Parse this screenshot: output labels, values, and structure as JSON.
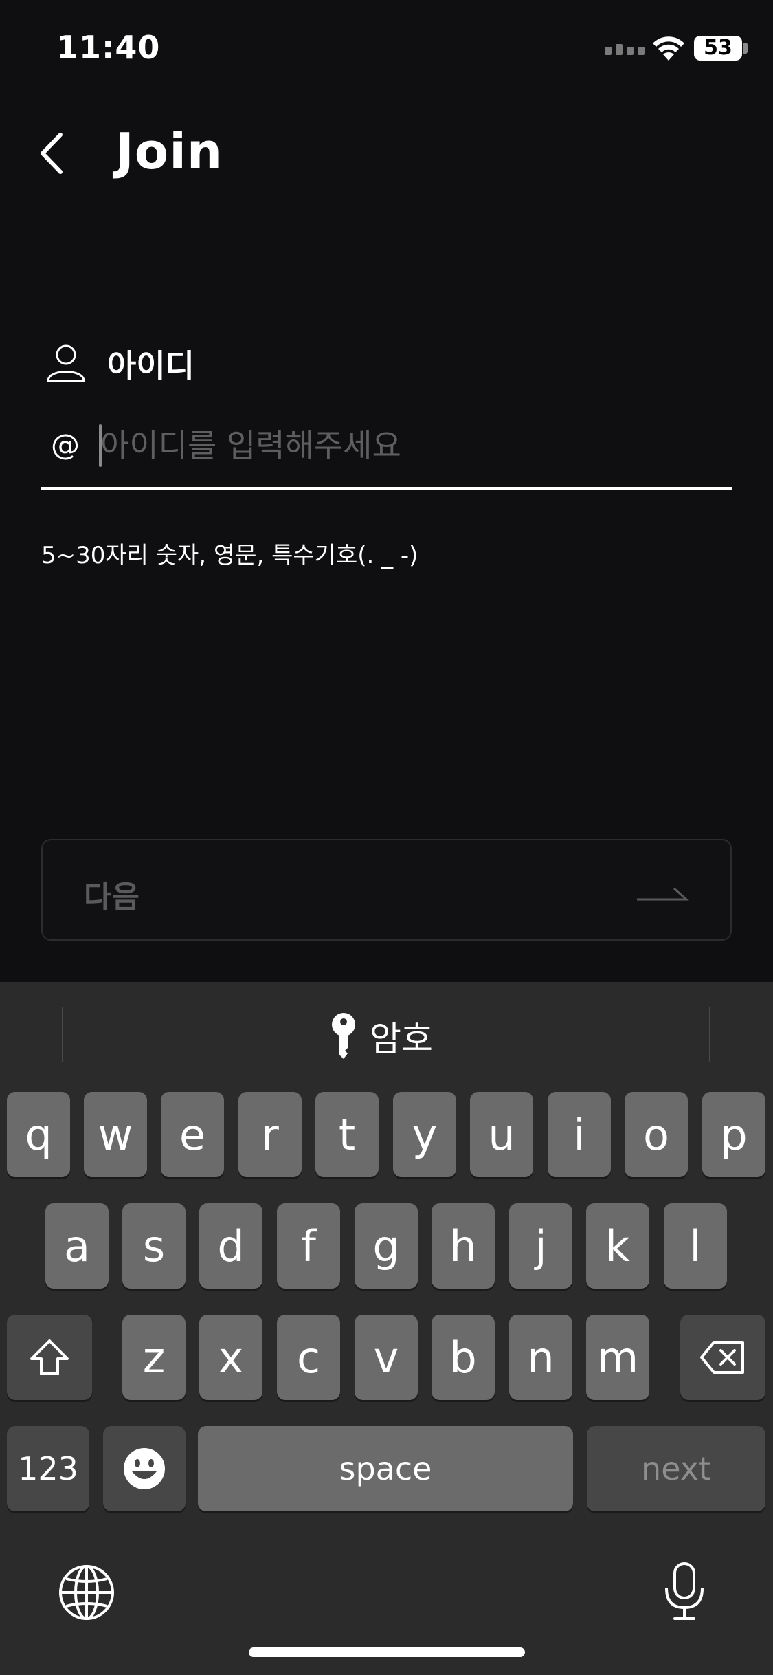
{
  "status": {
    "time": "11:40",
    "battery": "53"
  },
  "header": {
    "title": "Join"
  },
  "id_section": {
    "label": "아이디",
    "prefix": "@",
    "placeholder": "아이디를 입력해주세요",
    "value": "",
    "helper": "5~30자리 숫자, 영문, 특수기호(. _ -)"
  },
  "next_button": {
    "label": "다음"
  },
  "keyboard": {
    "suggestion": "암호",
    "row1": [
      "q",
      "w",
      "e",
      "r",
      "t",
      "y",
      "u",
      "i",
      "o",
      "p"
    ],
    "row2": [
      "a",
      "s",
      "d",
      "f",
      "g",
      "h",
      "j",
      "k",
      "l"
    ],
    "row3": [
      "z",
      "x",
      "c",
      "v",
      "b",
      "n",
      "m"
    ],
    "numbers_label": "123",
    "space_label": "space",
    "return_label": "next"
  }
}
